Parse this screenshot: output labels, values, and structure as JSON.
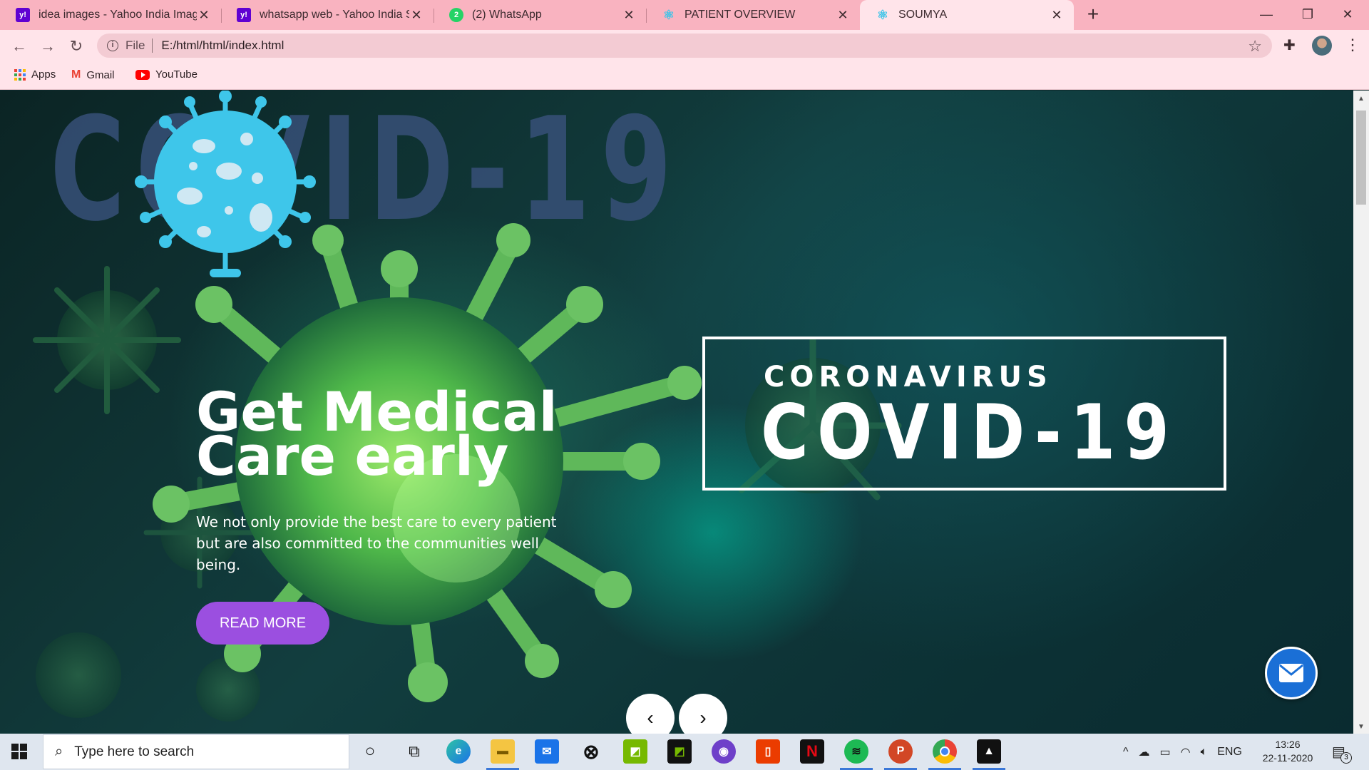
{
  "browser": {
    "tabs": [
      {
        "title": "idea images - Yahoo India Image",
        "icon": "yahoo-icon",
        "favicon_text": "y!"
      },
      {
        "title": "whatsapp web - Yahoo India Sear",
        "icon": "yahoo-icon",
        "favicon_text": "y!"
      },
      {
        "title": "(2) WhatsApp",
        "icon": "whatsapp-icon",
        "favicon_text": "2"
      },
      {
        "title": "PATIENT OVERVIEW",
        "icon": "react-icon",
        "favicon_text": "⚛"
      },
      {
        "title": "SOUMYA",
        "icon": "react-icon",
        "favicon_text": "⚛"
      }
    ],
    "active_tab": 4,
    "address": {
      "scheme_label": "File",
      "url": "E:/html/html/index.html"
    },
    "bookmarks": [
      {
        "label": "Apps",
        "icon": "apps-grid-icon"
      },
      {
        "label": "Gmail",
        "icon": "gmail-icon"
      },
      {
        "label": "YouTube",
        "icon": "youtube-icon"
      }
    ]
  },
  "page": {
    "wordmark": "COVID-19",
    "hero": {
      "title_line1": "Get Medical",
      "title_line2": "Care early",
      "text": "We not only provide the best care to every patient but are also committed to the communities well being.",
      "button": "READ MORE"
    },
    "covid_box": {
      "small": "CORONAVIRUS",
      "big": "COVID-19"
    },
    "carousel": {
      "prev": "‹",
      "next": "›"
    }
  },
  "taskbar": {
    "search_placeholder": "Type here to search",
    "apps": [
      "cortana",
      "task-view",
      "edge",
      "file-explorer",
      "mail",
      "xbox",
      "nvidia-geforce",
      "nvidia",
      "github",
      "office",
      "netflix",
      "spotify",
      "powerpoint",
      "chrome",
      "photos"
    ],
    "tray": {
      "language": "ENG",
      "time": "13:26",
      "date": "22-11-2020",
      "notifications": "3"
    }
  },
  "colors": {
    "tab_bar": "#f9b3c0",
    "toolbar": "#ffe4ea",
    "accent_button": "#9b4fe0",
    "fab": "#1a6fd6",
    "wordmark": "#37507a",
    "virus_logo": "#3ec6ea"
  }
}
